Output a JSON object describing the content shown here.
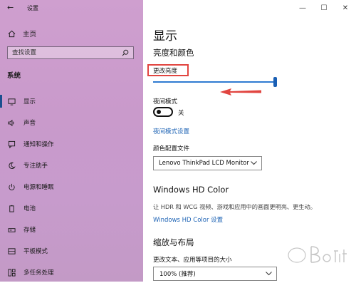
{
  "window": {
    "title": "设置",
    "minimize_glyph": "—",
    "maximize_glyph": "☐",
    "close_glyph": "✕"
  },
  "sidebar": {
    "home_label": "主页",
    "search_placeholder": "查找设置",
    "section_title": "系统",
    "items": [
      {
        "label": "显示",
        "icon": "monitor-icon",
        "active": true
      },
      {
        "label": "声音",
        "icon": "speaker-icon",
        "active": false
      },
      {
        "label": "通知和操作",
        "icon": "notification-icon",
        "active": false
      },
      {
        "label": "专注助手",
        "icon": "moon-icon",
        "active": false
      },
      {
        "label": "电源和睡眠",
        "icon": "power-icon",
        "active": false
      },
      {
        "label": "电池",
        "icon": "battery-icon",
        "active": false
      },
      {
        "label": "存储",
        "icon": "storage-icon",
        "active": false
      },
      {
        "label": "平板模式",
        "icon": "tablet-icon",
        "active": false
      },
      {
        "label": "多任务处理",
        "icon": "multitask-icon",
        "active": false
      }
    ]
  },
  "main": {
    "page_title": "显示",
    "brightness_heading": "亮度和颜色",
    "brightness_label": "更改亮度",
    "brightness_value": 1.0,
    "night_light_label": "夜间模式",
    "night_light_state": "关",
    "night_light_link": "夜间模式设置",
    "color_profile_label": "颜色配置文件",
    "color_profile_value": "Lenovo ThinkPad LCD Monitor",
    "hdr_heading": "Windows HD Color",
    "hdr_description": "让 HDR 和 WCG 视频、游戏和应用中的画面更明亮、更生动。",
    "hdr_link": "Windows HD Color 设置",
    "scale_heading": "缩放与布局",
    "scale_label": "更改文本、应用等项目的大小",
    "scale_value": "100% (推荐)"
  },
  "colors": {
    "accent": "#1f64b5",
    "annotation_red": "#e14540"
  }
}
